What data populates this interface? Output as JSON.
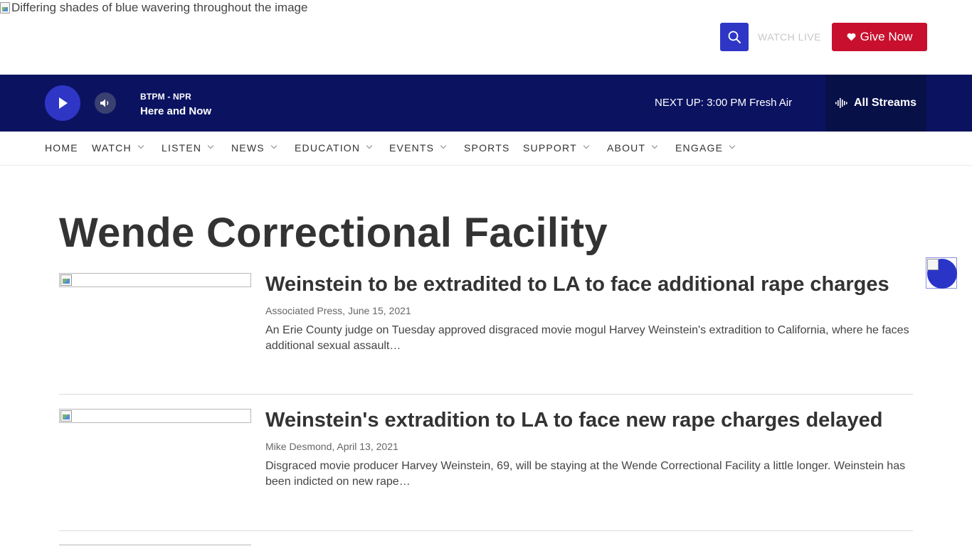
{
  "header": {
    "logo_alt": "Differing shades of blue wavering throughout the image",
    "watch_live": "WATCH LIVE",
    "give_now": "Give Now"
  },
  "player": {
    "station": "BTPM - NPR",
    "program": "Here and Now",
    "next_up": "NEXT UP: 3:00 PM Fresh Air",
    "all_streams": "All Streams"
  },
  "nav": {
    "items": [
      {
        "label": "HOME",
        "dropdown": false
      },
      {
        "label": "WATCH",
        "dropdown": true
      },
      {
        "label": "LISTEN",
        "dropdown": true
      },
      {
        "label": "NEWS",
        "dropdown": true
      },
      {
        "label": "EDUCATION",
        "dropdown": true
      },
      {
        "label": "EVENTS",
        "dropdown": true
      },
      {
        "label": "SPORTS",
        "dropdown": false
      },
      {
        "label": "SUPPORT",
        "dropdown": true
      },
      {
        "label": "ABOUT",
        "dropdown": true
      },
      {
        "label": "ENGAGE",
        "dropdown": true
      }
    ]
  },
  "page": {
    "title": "Wende Correctional Facility"
  },
  "articles": [
    {
      "title": "Weinstein to be extradited to LA to face additional rape charges",
      "byline": "Associated Press, June 15, 2021",
      "teaser": "An Erie County judge on Tuesday approved disgraced movie mogul Harvey Weinstein's extradition to California, where he faces additional sexual assault…"
    },
    {
      "title": "Weinstein's extradition to LA to face new rape charges delayed",
      "byline": "Mike Desmond, April 13, 2021",
      "teaser": "Disgraced movie producer Harvey Weinstein, 69, will be staying at the Wende Correctional Facility a little longer. Weinstein has been indicted on new rape…"
    }
  ],
  "colors": {
    "brand_blue": "#2f36c6",
    "player_bg": "#0b1361",
    "give_red": "#c8102e"
  }
}
